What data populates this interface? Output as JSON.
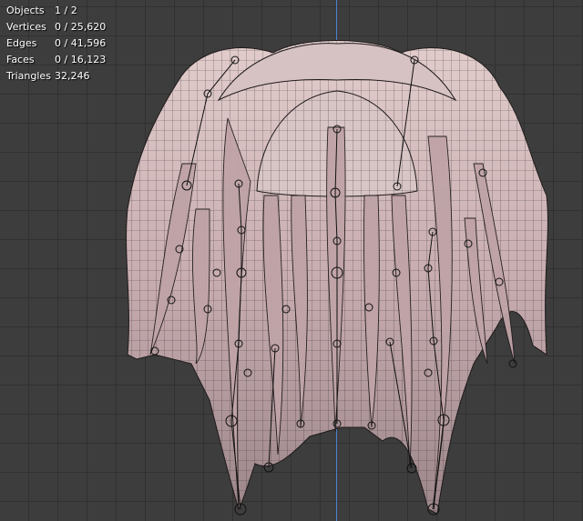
{
  "viewport": {
    "name": "3d-viewport",
    "colors": {
      "grid": "#313131",
      "background": "#3d3d3d",
      "axis": "#4b7fd1",
      "mesh": "#cbb2b4"
    },
    "stats": [
      {
        "label": "Objects",
        "value": "1 / 2"
      },
      {
        "label": "Vertices",
        "value": "0 / 25,620"
      },
      {
        "label": "Edges",
        "value": "0 / 41,596"
      },
      {
        "label": "Faces",
        "value": "0 / 16,123"
      },
      {
        "label": "Triangles",
        "value": "32,246"
      }
    ],
    "object": {
      "icon": "hair-mesh-icon"
    }
  }
}
